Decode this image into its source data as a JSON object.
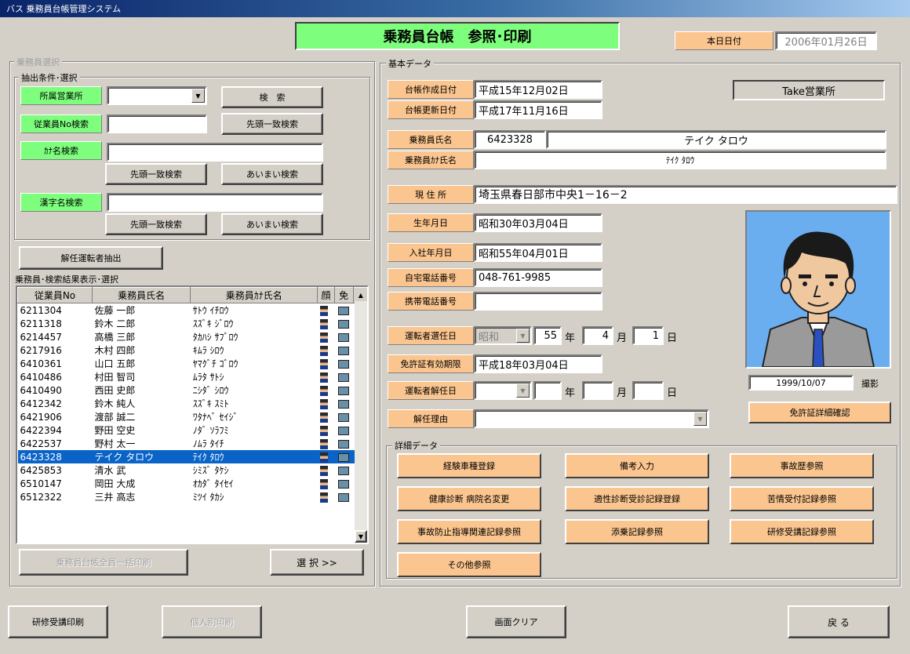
{
  "window": {
    "title": "バス 乗務員台帳管理システム"
  },
  "header": {
    "screen_title": "乗務員台帳　参照･印刷",
    "today_label": "本日日付",
    "today_value": "2006年01月26日"
  },
  "search_panel": {
    "group_label": "乗務員選択",
    "criteria_label": "抽出条件･選択",
    "office_label": "所属営業所",
    "office_value": "",
    "search_button": "検　索",
    "empno_label": "従業員No検索",
    "empno_value": "",
    "prefix_search_button": "先頭一致検索",
    "kana_label": "ｶﾅ名検索",
    "kana_value": "",
    "kana_prefix_button": "先頭一致検索",
    "kana_fuzzy_button": "あいまい検索",
    "kanji_label": "漢字名検索",
    "kanji_value": "",
    "kanji_prefix_button": "先頭一致検索",
    "kanji_fuzzy_button": "あいまい検索",
    "dismissed_button": "解任運転者抽出"
  },
  "results": {
    "group_label": "乗務員･検索結果表示･選択",
    "columns": [
      "従業員No",
      "乗務員氏名",
      "乗務員ｶﾅ氏名",
      "顔",
      "免"
    ],
    "rows": [
      {
        "no": "6211304",
        "name": "佐藤 一郎",
        "kana": "ｻﾄｳ ｲﾁﾛｳ"
      },
      {
        "no": "6211318",
        "name": "鈴木 二郎",
        "kana": "ｽｽﾞｷ ｼﾞﾛｳ"
      },
      {
        "no": "6214457",
        "name": "高橋 三郎",
        "kana": "ﾀｶﾊｼ ｻﾌﾞﾛｳ"
      },
      {
        "no": "6217916",
        "name": "木村 四郎",
        "kana": "ｷﾑﾗ ｼﾛｳ"
      },
      {
        "no": "6410361",
        "name": "山口 五郎",
        "kana": "ﾔﾏｸﾞﾁ ｺﾞﾛｳ"
      },
      {
        "no": "6410486",
        "name": "村田 智司",
        "kana": "ﾑﾗﾀ ｻﾄｼ"
      },
      {
        "no": "6410490",
        "name": "西田 史郎",
        "kana": "ﾆｼﾀﾞ ｼﾛｳ"
      },
      {
        "no": "6412342",
        "name": "鈴木 純人",
        "kana": "ｽｽﾞｷ ｽﾐﾄ"
      },
      {
        "no": "6421906",
        "name": "渡部 誠二",
        "kana": "ﾜﾀﾅﾍﾞ ｾｲｼﾞ"
      },
      {
        "no": "6422394",
        "name": "野田 空史",
        "kana": "ﾉﾀﾞ ｿﾗﾌﾐ"
      },
      {
        "no": "6422537",
        "name": "野村 太一",
        "kana": "ﾉﾑﾗ ﾀｲﾁ"
      },
      {
        "no": "6423328",
        "name": "テイク タロウ",
        "kana": "ﾃｲｸ ﾀﾛｳ"
      },
      {
        "no": "6425853",
        "name": "清水 武",
        "kana": "ｼﾐｽﾞ ﾀｹｼ"
      },
      {
        "no": "6510147",
        "name": "岡田 大成",
        "kana": "ｵｶﾀﾞ ﾀｲｾｲ"
      },
      {
        "no": "6512322",
        "name": "三井 高志",
        "kana": "ﾐﾂｲ ﾀｶｼ"
      }
    ],
    "selected_index": 11,
    "print_all_button": "乗務員台帳全員一括印刷",
    "select_button": "選 択 >>"
  },
  "basic": {
    "group_label": "基本データ",
    "created_label": "台帳作成日付",
    "created_value": "平成15年12月02日",
    "updated_label": "台帳更新日付",
    "updated_value": "平成17年11月16日",
    "office_value": "Take営業所",
    "name_label": "乗務員氏名",
    "emp_no": "6423328",
    "name_value": "テイク タロウ",
    "kana_label": "乗務員ｶﾅ氏名",
    "kana_value": "ﾃｲｸ ﾀﾛｳ",
    "address_label": "現 住 所",
    "address_value": "埼玉県春日部市中央1－16－2",
    "birth_label": "生年月日",
    "birth_value": "昭和30年03月04日",
    "join_label": "入社年月日",
    "join_value": "昭和55年04月01日",
    "tel_label": "自宅電話番号",
    "tel_value": "048-761-9985",
    "mobile_label": "携帯電話番号",
    "mobile_value": "",
    "appoint_label": "運転者選任日",
    "appoint_era": "昭和",
    "appoint_year": "55",
    "appoint_month": "4",
    "appoint_day": "1",
    "year_unit": "年",
    "month_unit": "月",
    "day_unit": "日",
    "license_label": "免許証有効期限",
    "license_value": "平成18年03月04日",
    "dismiss_label": "運転者解任日",
    "reason_label": "解任理由",
    "reason_value": "",
    "photo_date": "1999/10/07",
    "photo_label": "撮影",
    "license_detail_button": "免許証詳細確認"
  },
  "detail": {
    "group_label": "詳細データ",
    "buttons": [
      "経験車種登録",
      "備考入力",
      "事故歴参照",
      "健康診断 病院名変更",
      "適性診断受診記録登録",
      "苦情受付記録参照",
      "事故防止指導関連記録参照",
      "添乗記録参照",
      "研修受講記録参照",
      "その他参照"
    ]
  },
  "footer": {
    "training_print": "研修受講印刷",
    "personal_print": "個人別印刷",
    "clear": "画面クリア",
    "back": "戻 る"
  }
}
